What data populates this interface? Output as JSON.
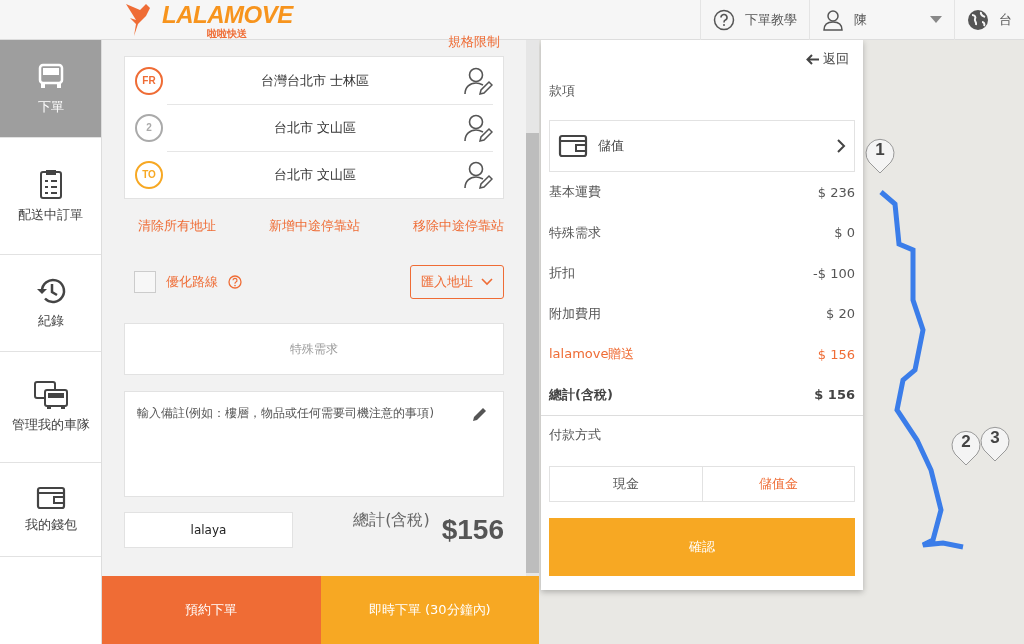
{
  "header": {
    "brand": "LALAMOVE",
    "brand_sub": "啦啦快送",
    "help": "下單教學",
    "user": "陳",
    "language": "台"
  },
  "sidebar": {
    "items": [
      {
        "label": "下單",
        "selected": true
      },
      {
        "label": "配送中訂單",
        "selected": false
      },
      {
        "label": "紀錄",
        "selected": false
      },
      {
        "label": "管理我的車隊",
        "selected": false
      },
      {
        "label": "我的錢包",
        "selected": false
      }
    ]
  },
  "order": {
    "spec_link": "規格限制",
    "waypoints": [
      {
        "kind": "from",
        "badge": "FR",
        "address": "台灣台北市 士林區"
      },
      {
        "kind": "stop",
        "badge": "2",
        "address": "台北市 文山區"
      },
      {
        "kind": "to",
        "badge": "TO",
        "address": "台北市 文山區"
      }
    ],
    "actions": [
      "清除所有地址",
      "新增中途停靠站",
      "移除中途停靠站"
    ],
    "optimize": {
      "label": "優化路線",
      "checked": false
    },
    "import_button": "匯入地址",
    "special_request": "特殊需求",
    "notes_placeholder": "輸入備註(例如：樓層，物品或任何需要司機注意的事項)",
    "contact_name": "lalaya",
    "total_label": "總計(含稅)",
    "total": "$156",
    "buttons": [
      {
        "kind": "schedule",
        "label": "預約下單"
      },
      {
        "kind": "now",
        "label": "即時下單 (30分鐘內)"
      }
    ]
  },
  "price_panel": {
    "back": "返回",
    "section": "款項",
    "payment_account": "儲值",
    "rows": [
      {
        "kind": "normal",
        "label": "基本運費",
        "value": "$ 236"
      },
      {
        "kind": "normal",
        "label": "特殊需求",
        "value": "$ 0"
      },
      {
        "kind": "normal",
        "label": "折扣",
        "value": "-$ 100"
      },
      {
        "kind": "normal",
        "label": "附加費用",
        "value": "$ 20"
      },
      {
        "kind": "promo",
        "label": "lalamove贈送",
        "value": "$ 156"
      },
      {
        "kind": "total",
        "label": "總計(含稅)",
        "value": "$ 156"
      }
    ],
    "payment_label": "付款方式",
    "payment_methods": [
      {
        "label": "現金",
        "selected": false
      },
      {
        "label": "儲值金",
        "selected": true
      }
    ],
    "confirm": "確認"
  },
  "map": {
    "pins": [
      {
        "label": "1"
      },
      {
        "label": "2"
      },
      {
        "label": "3"
      }
    ]
  }
}
